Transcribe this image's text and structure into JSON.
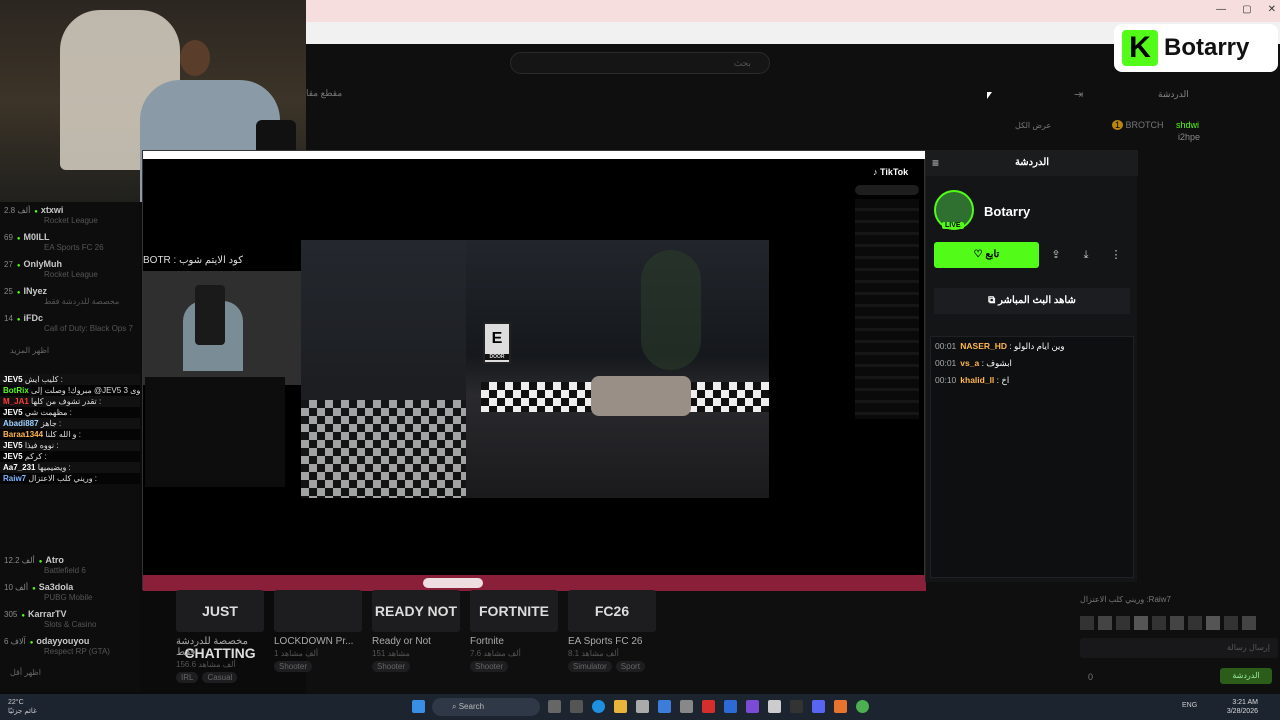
{
  "browser": {
    "window_controls": [
      "—",
      "▢",
      "✕"
    ]
  },
  "kick": {
    "search_placeholder": "بحث",
    "nav_label": "مقطع مقا",
    "chat_title": "الدردشة",
    "see_all": "عرض الكل",
    "ghost_chat": [
      {
        "name": "BROTCH",
        "text": "shdwi"
      },
      {
        "name": "",
        "text": "i2hpe"
      }
    ]
  },
  "logo": {
    "letter": "K",
    "text": "Botarry"
  },
  "overlay_caption": "كود الايتم شوب : BOTR",
  "left_channels": [
    {
      "name": "xtxwi",
      "views": "2.8 ألف",
      "game": "Rocket League"
    },
    {
      "name": "M0ILL",
      "views": "69",
      "game": "EA Sports FC 26"
    },
    {
      "name": "OnlyMuh",
      "views": "27",
      "game": "Rocket League"
    },
    {
      "name": "INyez",
      "views": "25",
      "game": "مخصصة للدردشة فقط"
    },
    {
      "name": "iFDc",
      "views": "14",
      "game": "Call of Duty: Black Ops 7"
    }
  ],
  "left_show_more": "اظهر المزيد",
  "overlay_chat": [
    {
      "user": "JEV5",
      "color": "#ffffff",
      "text": "كليب ايش :"
    },
    {
      "user": "BotRix",
      "color": "#53fc18",
      "text": "مبروك! وصلت إلى @JEV5 المستوى 3!"
    },
    {
      "user": "M_JA1",
      "color": "#ff3b3b",
      "text": "تقدر تشوف من كلها :"
    },
    {
      "user": "JEV5",
      "color": "#ffffff",
      "text": "مظهمت شي :"
    },
    {
      "user": "Abadi887",
      "color": "#9fd0ff",
      "text": "جاهز :"
    },
    {
      "user": "Baraa1344",
      "color": "#ffb74d",
      "text": "و الله كلنا :"
    },
    {
      "user": "JEV5",
      "color": "#ffffff",
      "text": "نووه فيذا :"
    },
    {
      "user": "JEV5",
      "color": "#ffffff",
      "text": "كركم :"
    },
    {
      "user": "Aa7_231",
      "color": "#ffffff",
      "text": "ويضيميها :"
    },
    {
      "user": "Raiw7",
      "color": "#7fb3ff",
      "text": "وريني كلب الاعتزال :"
    }
  ],
  "tiktok": {
    "logo": "TikTok"
  },
  "game": {
    "door_label": "DOOR",
    "door_letter": "E"
  },
  "chat_panel": {
    "header": "الدردشة",
    "streamer": "Botarry",
    "live_badge": "LIVE",
    "follow_label": "تابع",
    "watch_label": "شاهد البث المباشر",
    "messages": [
      {
        "time": "00:01",
        "user": "NASER_HD",
        "color": "#ffb74d",
        "text": "وين ايام دالولو"
      },
      {
        "time": "00:01",
        "user": "vs_a",
        "color": "#ffb74d",
        "text": "ابشوف"
      },
      {
        "time": "00:10",
        "user": "khalid_ll",
        "color": "#ffb74d",
        "text": "اخ"
      }
    ]
  },
  "bottom_cards": [
    {
      "img": "JUST CHATTING",
      "title": "مخصصة للدردشة فقط",
      "sub": "156.6 ألف مشاهد",
      "tags": [
        "IRL",
        "Casual"
      ]
    },
    {
      "img": "",
      "title": "LOCKDOWN Pr...",
      "sub": "1 ألف مشاهد",
      "tags": [
        "Shooter"
      ]
    },
    {
      "img": "READY NOT",
      "title": "Ready or Not",
      "sub": "151 مشاهد",
      "tags": [
        "Shooter"
      ]
    },
    {
      "img": "FORTNITE",
      "title": "Fortnite",
      "sub": "7.6 ألف مشاهد",
      "tags": [
        "Shooter"
      ]
    },
    {
      "img": "FC26",
      "title": "EA Sports FC 26",
      "sub": "8.1 ألف مشاهد",
      "tags": [
        "Simulator",
        "Sport"
      ]
    }
  ],
  "left_channels_2": [
    {
      "name": "Atro",
      "views": "12.2 ألف",
      "game": "Battlefield 6"
    },
    {
      "name": "Sa3dola",
      "views": "10 ألف",
      "game": "PUBG Mobile"
    },
    {
      "name": "KarrarTV",
      "views": "305",
      "game": "Slots & Casino"
    },
    {
      "name": "odayyouyou",
      "views": "6 آلاف",
      "game": "Respect RP (GTA)"
    }
  ],
  "left_show_less": "اظهر أقل",
  "right_ghost": {
    "mention": "Raiw7: وريني كلب الاعتزال",
    "send_placeholder": "إرسال رسالة",
    "send_button": "الدردشة",
    "count": "0"
  },
  "taskbar": {
    "weather_temp": "22°C",
    "weather_desc": "غائم جزئيًا",
    "search": "Search",
    "lang": "ENG",
    "time": "3:21 AM",
    "date": "3/28/2026"
  },
  "colors": {
    "kick_green": "#53fc18"
  }
}
